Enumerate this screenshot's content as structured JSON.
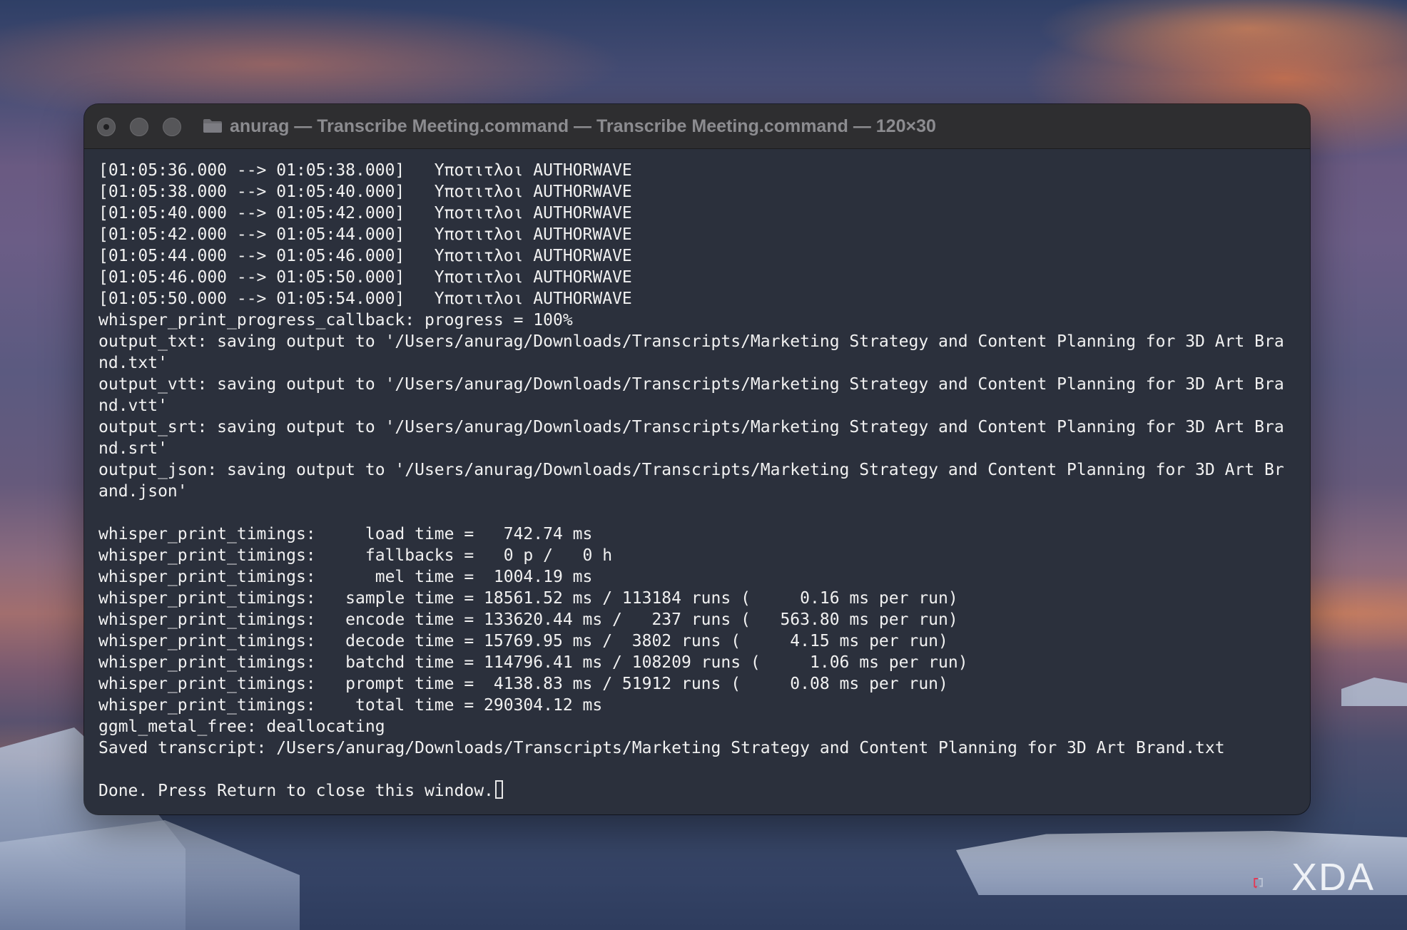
{
  "window": {
    "title": "anurag — Transcribe Meeting.command — Transcribe Meeting.command — 120×30"
  },
  "terminal": {
    "lines": [
      "[01:05:36.000 --> 01:05:38.000]   Υποτιτλοι AUTHORWAVE",
      "[01:05:38.000 --> 01:05:40.000]   Υποτιτλοι AUTHORWAVE",
      "[01:05:40.000 --> 01:05:42.000]   Υποτιτλοι AUTHORWAVE",
      "[01:05:42.000 --> 01:05:44.000]   Υποτιτλοι AUTHORWAVE",
      "[01:05:44.000 --> 01:05:46.000]   Υποτιτλοι AUTHORWAVE",
      "[01:05:46.000 --> 01:05:50.000]   Υποτιτλοι AUTHORWAVE",
      "[01:05:50.000 --> 01:05:54.000]   Υποτιτλοι AUTHORWAVE",
      "whisper_print_progress_callback: progress = 100%",
      "output_txt: saving output to '/Users/anurag/Downloads/Transcripts/Marketing Strategy and Content Planning for 3D Art Bra",
      "nd.txt'",
      "output_vtt: saving output to '/Users/anurag/Downloads/Transcripts/Marketing Strategy and Content Planning for 3D Art Bra",
      "nd.vtt'",
      "output_srt: saving output to '/Users/anurag/Downloads/Transcripts/Marketing Strategy and Content Planning for 3D Art Bra",
      "nd.srt'",
      "output_json: saving output to '/Users/anurag/Downloads/Transcripts/Marketing Strategy and Content Planning for 3D Art Br",
      "and.json'",
      "",
      "whisper_print_timings:     load time =   742.74 ms",
      "whisper_print_timings:     fallbacks =   0 p /   0 h",
      "whisper_print_timings:      mel time =  1004.19 ms",
      "whisper_print_timings:   sample time = 18561.52 ms / 113184 runs (     0.16 ms per run)",
      "whisper_print_timings:   encode time = 133620.44 ms /   237 runs (   563.80 ms per run)",
      "whisper_print_timings:   decode time = 15769.95 ms /  3802 runs (     4.15 ms per run)",
      "whisper_print_timings:   batchd time = 114796.41 ms / 108209 runs (     1.06 ms per run)",
      "whisper_print_timings:   prompt time =  4138.83 ms / 51912 runs (     0.08 ms per run)",
      "whisper_print_timings:    total time = 290304.12 ms",
      "ggml_metal_free: deallocating",
      "Saved transcript: /Users/anurag/Downloads/Transcripts/Marketing Strategy and Content Planning for 3D Art Brand.txt",
      "",
      "Done. Press Return to close this window."
    ]
  },
  "watermark": {
    "brand": "XDA"
  },
  "colors": {
    "terminal_bg": "#2b303c",
    "titlebar_bg": "#2e2e30",
    "text": "#f1f1f1",
    "title_text": "#8c8c90",
    "xda_accent": "#e23a56"
  },
  "icons": [
    "close-button",
    "minimize-button",
    "zoom-button",
    "folder-icon",
    "text-cursor",
    "xda-logo-icon"
  ]
}
